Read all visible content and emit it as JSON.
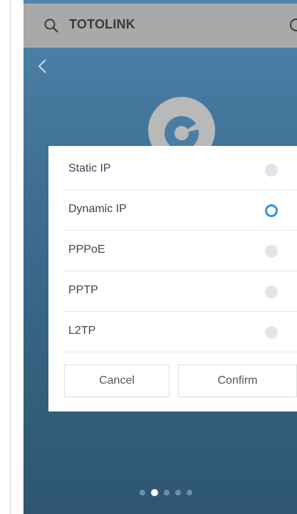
{
  "search": {
    "query": "TOTOLINK",
    "search_icon": "search-icon",
    "right_icon": "circle-icon"
  },
  "nav": {
    "back_icon": "chevron-left-icon"
  },
  "logo": {
    "icon": "totolink-logo-icon"
  },
  "dialog": {
    "options": [
      {
        "label": "Static IP",
        "selected": false
      },
      {
        "label": "Dynamic IP",
        "selected": true
      },
      {
        "label": "PPPoE",
        "selected": false
      },
      {
        "label": "PPTP",
        "selected": false
      },
      {
        "label": "L2TP",
        "selected": false
      }
    ],
    "cancel_label": "Cancel",
    "confirm_label": "Confirm"
  },
  "pager": {
    "count": 5,
    "active_index": 1
  },
  "colors": {
    "accent": "#3592da",
    "background_top": "#4f84ab",
    "background_bottom": "#2e5672",
    "search_bar": "#a9a9a9"
  }
}
